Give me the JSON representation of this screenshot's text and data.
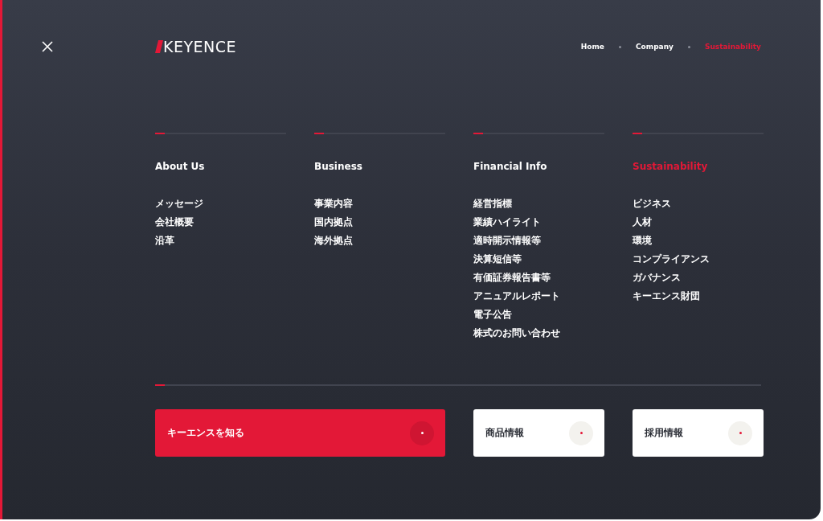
{
  "logo": {
    "text": "KEYENCE"
  },
  "breadcrumb": [
    {
      "label": "Home",
      "selected": false
    },
    {
      "label": "Company",
      "selected": false
    },
    {
      "label": "Sustainability",
      "selected": true
    }
  ],
  "columns": [
    {
      "heading": "About Us",
      "selected": false,
      "items": [
        "メッセージ",
        "会社概要",
        "沿革"
      ]
    },
    {
      "heading": "Business",
      "selected": false,
      "items": [
        "事業内容",
        "国内拠点",
        "海外拠点"
      ]
    },
    {
      "heading": "Financial Info",
      "selected": false,
      "items": [
        "経営指標",
        "業績ハイライト",
        "適時開示情報等",
        "決算短信等",
        "有価証券報告書等",
        "アニュアルレポート",
        "電子公告",
        "株式のお問い合わせ"
      ]
    },
    {
      "heading": "Sustainability",
      "selected": true,
      "items": [
        "ビジネス",
        "人材",
        "環境",
        "コンプライアンス",
        "ガバナンス",
        "キーエンス財団"
      ]
    }
  ],
  "cards": [
    {
      "label": "キーエンスを知る",
      "kind": "primary"
    },
    {
      "label": "商品情報",
      "kind": "light"
    },
    {
      "label": "採用情報",
      "kind": "light"
    }
  ]
}
